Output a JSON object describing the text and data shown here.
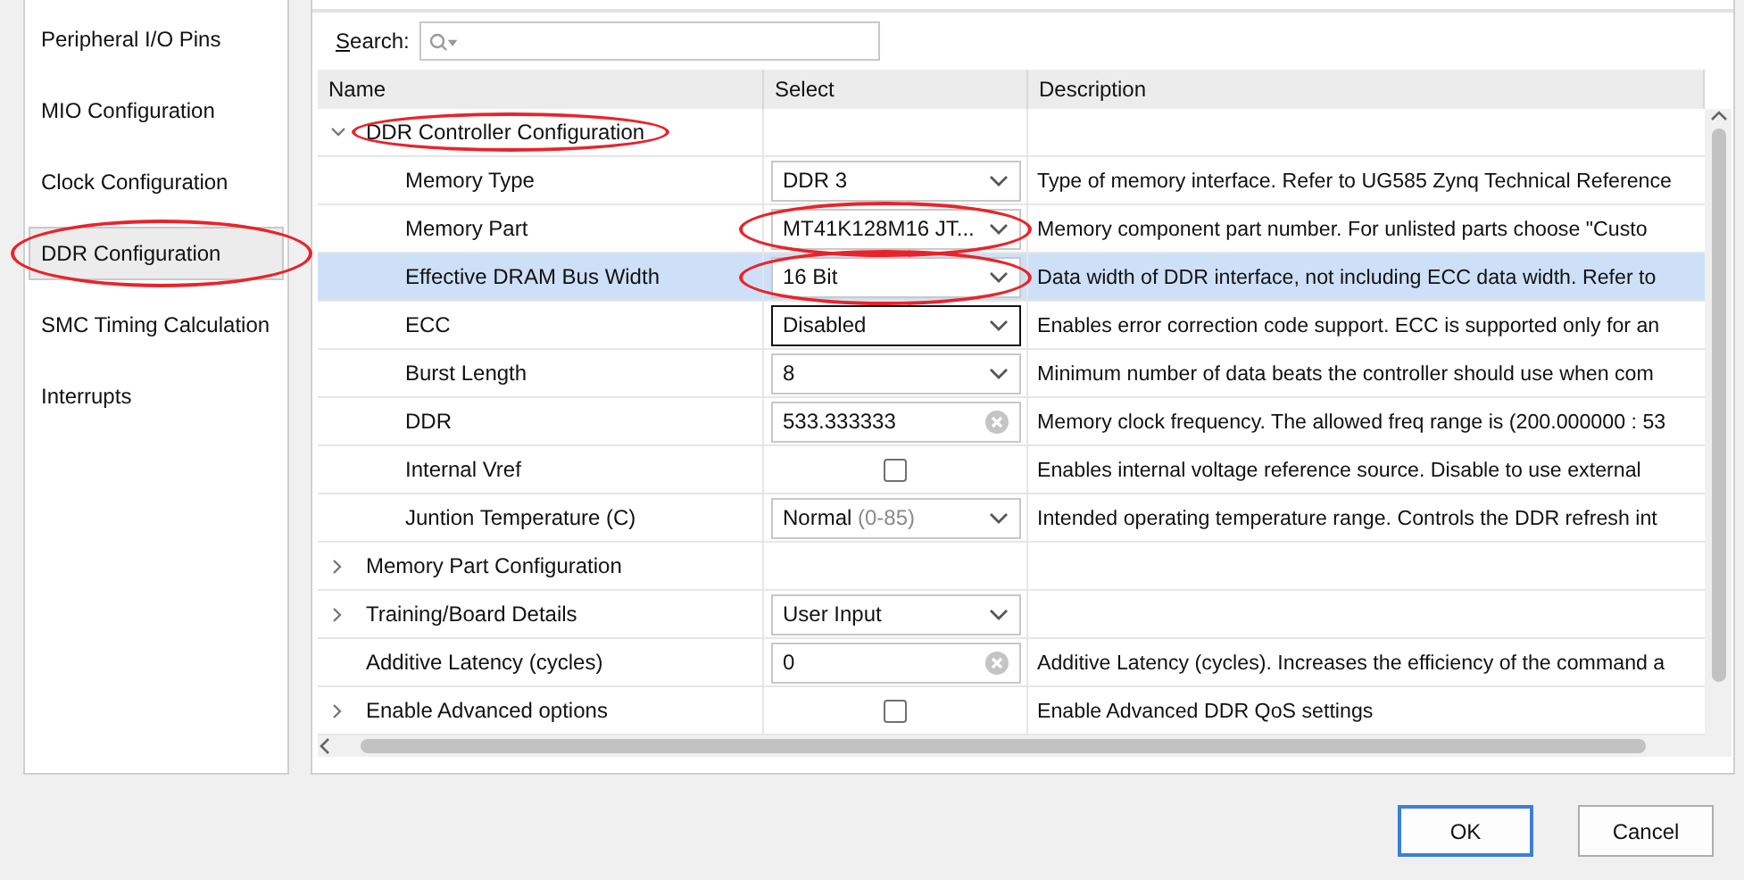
{
  "sidebar": {
    "items": [
      {
        "label": "Peripheral I/O Pins",
        "selected": false,
        "circled": false
      },
      {
        "label": "MIO Configuration",
        "selected": false,
        "circled": false
      },
      {
        "label": "Clock Configuration",
        "selected": false,
        "circled": false
      },
      {
        "label": "DDR Configuration",
        "selected": true,
        "circled": true
      },
      {
        "label": "SMC Timing Calculation",
        "selected": false,
        "circled": false
      },
      {
        "label": "Interrupts",
        "selected": false,
        "circled": false
      }
    ]
  },
  "search": {
    "label": "Search:"
  },
  "table": {
    "columns": [
      "Name",
      "Select",
      "Description"
    ],
    "rows": [
      {
        "name": "DDR Controller Configuration",
        "kind": "group",
        "expanded": true,
        "selected": false,
        "circled": true,
        "children": [
          {
            "name": "Memory Type",
            "kind": "dropdown",
            "value": "DDR 3",
            "description": "Type of memory interface. Refer to UG585 Zynq Technical Reference",
            "selected": false,
            "focused": false,
            "circled": false
          },
          {
            "name": "Memory Part",
            "kind": "dropdown",
            "value": "MT41K128M16 JT...",
            "description": "Memory component part number. For unlisted parts choose \"Custo",
            "selected": false,
            "focused": false,
            "circled": true
          },
          {
            "name": "Effective DRAM Bus Width",
            "kind": "dropdown",
            "value": "16 Bit",
            "description": "Data width of DDR interface, not including ECC data width. Refer to",
            "selected": true,
            "focused": false,
            "circled": true
          },
          {
            "name": "ECC",
            "kind": "dropdown",
            "value": "Disabled",
            "description": "Enables error correction code support. ECC is supported only for an",
            "selected": false,
            "focused": true,
            "circled": false
          },
          {
            "name": "Burst Length",
            "kind": "dropdown",
            "value": "8",
            "description": "Minimum number of data beats the controller should use when com",
            "selected": false,
            "focused": false,
            "circled": false
          },
          {
            "name": "DDR",
            "kind": "text",
            "value": "533.333333",
            "description": "Memory clock frequency. The allowed freq range is (200.000000 : 53",
            "selected": false,
            "circled": false
          },
          {
            "name": "Internal Vref",
            "kind": "checkbox",
            "checked": false,
            "description": "Enables internal voltage reference source. Disable to use external",
            "selected": false,
            "circled": false
          },
          {
            "name": "Juntion Temperature (C)",
            "kind": "dropdown",
            "value": "Normal",
            "value_hint": "(0-85)",
            "description": "Intended operating temperature range. Controls the DDR refresh int",
            "selected": false,
            "focused": false,
            "circled": false
          }
        ]
      },
      {
        "name": "Memory Part Configuration",
        "kind": "group",
        "expanded": false,
        "selected": false,
        "circled": false
      },
      {
        "name": "Training/Board Details",
        "kind": "group-dropdown",
        "expanded": false,
        "value": "User Input",
        "selected": false,
        "focused": false,
        "circled": false
      },
      {
        "name": "Additive Latency (cycles)",
        "kind": "text",
        "value": "0",
        "description": "Additive Latency (cycles). Increases the efficiency of the command a",
        "selected": false,
        "circled": false
      },
      {
        "name": "Enable Advanced options",
        "kind": "group-checkbox",
        "expanded": false,
        "checked": false,
        "description": "Enable Advanced DDR QoS settings",
        "selected": false,
        "circled": false
      }
    ]
  },
  "buttons": [
    {
      "label": "OK",
      "kind": "default"
    },
    {
      "label": "Cancel",
      "kind": "normal"
    }
  ]
}
